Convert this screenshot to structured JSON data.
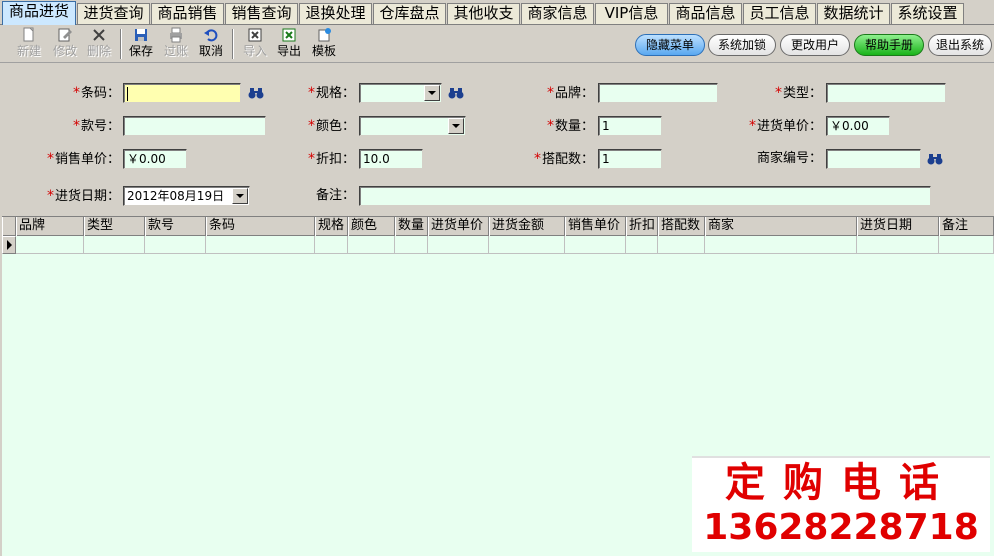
{
  "tabs": [
    {
      "label": "商品进货",
      "active": true
    },
    {
      "label": "进货查询",
      "active": false
    },
    {
      "label": "商品销售",
      "active": false
    },
    {
      "label": "销售查询",
      "active": false
    },
    {
      "label": "退换处理",
      "active": false
    },
    {
      "label": "仓库盘点",
      "active": false
    },
    {
      "label": "其他收支",
      "active": false
    },
    {
      "label": "商家信息",
      "active": false
    },
    {
      "label": "VIP信息",
      "active": false
    },
    {
      "label": "商品信息",
      "active": false
    },
    {
      "label": "员工信息",
      "active": false
    },
    {
      "label": "数据统计",
      "active": false
    },
    {
      "label": "系统设置",
      "active": false
    }
  ],
  "toolbar": {
    "new_label": "新建",
    "edit_label": "修改",
    "delete_label": "删除",
    "save_label": "保存",
    "post_label": "过账",
    "cancel_label": "取消",
    "import_label": "导入",
    "export_label": "导出",
    "template_label": "模板"
  },
  "top_buttons": {
    "hide_menu": "隐藏菜单",
    "lock_system": "系统加锁",
    "change_user": "更改用户",
    "help_manual": "帮助手册",
    "exit_system": "退出系统"
  },
  "form": {
    "barcode": {
      "label": "条码：",
      "value": ""
    },
    "spec": {
      "label": "规格：",
      "value": ""
    },
    "brand": {
      "label": "品牌：",
      "value": ""
    },
    "type": {
      "label": "类型：",
      "value": ""
    },
    "style_no": {
      "label": "款号：",
      "value": ""
    },
    "color": {
      "label": "颜色：",
      "value": ""
    },
    "quantity": {
      "label": "数量：",
      "value": "1"
    },
    "purchase_price": {
      "label": "进货单价：",
      "value": "￥0.00"
    },
    "sale_price": {
      "label": "销售单价：",
      "value": "￥0.00"
    },
    "discount": {
      "label": "折扣：",
      "value": "10.0"
    },
    "match_count": {
      "label": "搭配数：",
      "value": "1"
    },
    "vendor_code": {
      "label": "商家编号：",
      "value": ""
    },
    "purchase_date": {
      "label": "进货日期：",
      "value": "2012年08月19日"
    },
    "remark": {
      "label": "备注：",
      "value": ""
    },
    "required_mark": "*"
  },
  "grid": {
    "columns": [
      "品牌",
      "类型",
      "款号",
      "条码",
      "规格",
      "颜色",
      "数量",
      "进货单价",
      "进货金额",
      "销售单价",
      "折扣",
      "搭配数",
      "商家",
      "进货日期",
      "备注"
    ]
  },
  "ad": {
    "title": "定购电话",
    "phone": "13628228718"
  },
  "colors": {
    "field_bg": "#e8fff0",
    "focus_field_bg": "#ffffb0",
    "required": "#d40000",
    "ad_text": "#e00000"
  }
}
